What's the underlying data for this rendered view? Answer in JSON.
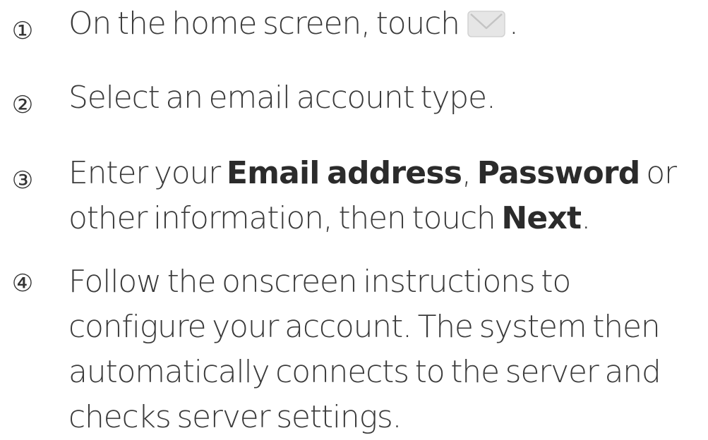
{
  "steps": [
    {
      "number": "①",
      "text_before_icon": "On the home screen, touch",
      "icon": "email-icon",
      "text_after_icon": "."
    },
    {
      "number": "②",
      "text": "Select an email account type."
    },
    {
      "number": "③",
      "line1_prefix": "Enter your ",
      "bold_email": "Email address",
      "comma": ", ",
      "bold_password": "Password",
      "line1_suffix": " or",
      "line2_prefix": "other information, then touch ",
      "bold_next": "Next",
      "line2_suffix": "."
    },
    {
      "number": "④",
      "lines": [
        "Follow the onscreen instructions to",
        "configure your account. The system then",
        "automatically connects to the server and",
        "checks server settings."
      ]
    }
  ],
  "colors": {
    "text": "#3a3a3a",
    "bold_text": "#2b2b2b",
    "icon_fill": "#e6e6e6",
    "icon_stroke": "#c4c4c4"
  }
}
